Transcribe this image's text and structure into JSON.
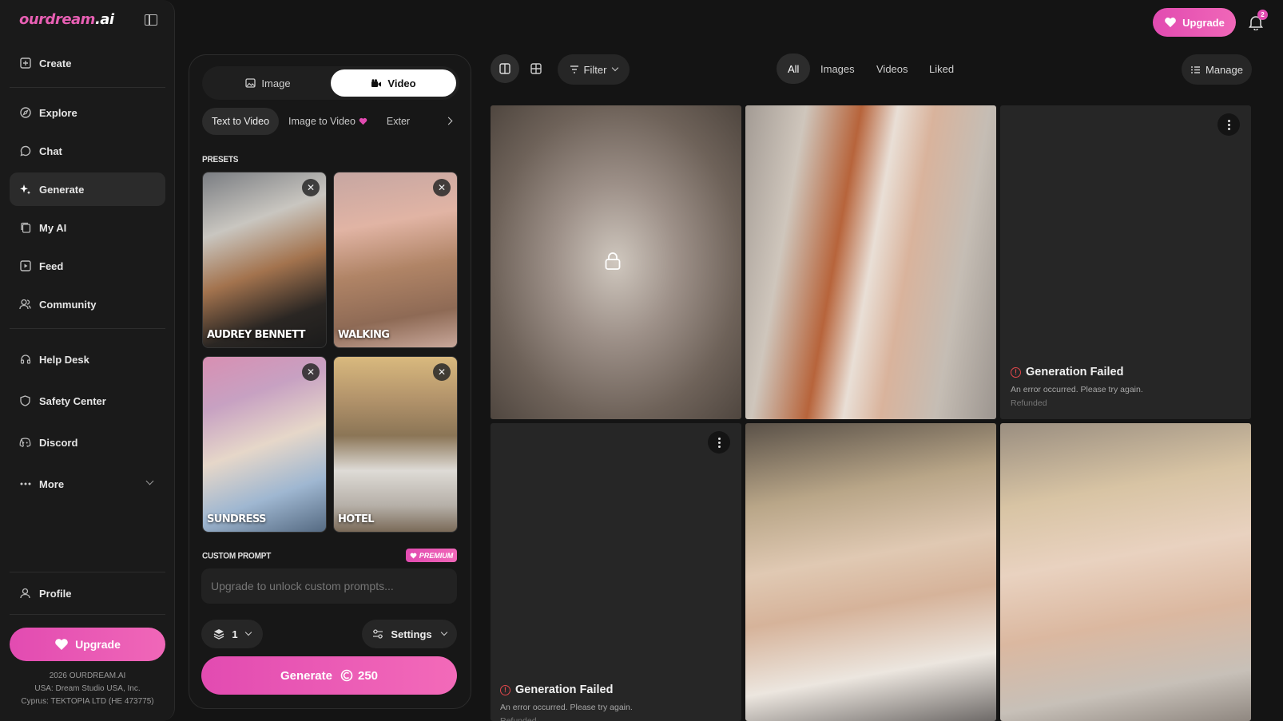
{
  "brand": {
    "name_part1": "ourdream",
    "name_part2": ".ai"
  },
  "sidebar": {
    "items": [
      {
        "label": "Create"
      },
      {
        "label": "Explore"
      },
      {
        "label": "Chat"
      },
      {
        "label": "Generate"
      },
      {
        "label": "My AI"
      },
      {
        "label": "Feed"
      },
      {
        "label": "Community"
      },
      {
        "label": "Help Desk"
      },
      {
        "label": "Safety Center"
      },
      {
        "label": "Discord"
      },
      {
        "label": "More"
      },
      {
        "label": "Profile"
      }
    ],
    "upgrade_label": "Upgrade",
    "footer": [
      "2026 OURDREAM.AI",
      "USA: Dream Studio USA, Inc.",
      "Cyprus: TEKTOPIA LTD (HE 473775)"
    ]
  },
  "topbar": {
    "upgrade_label": "Upgrade",
    "notification_count": "2"
  },
  "panel": {
    "type_tabs": [
      {
        "label": "Image"
      },
      {
        "label": "Video"
      }
    ],
    "modes": [
      {
        "label": "Text to Video"
      },
      {
        "label": "Image to Video"
      },
      {
        "label": "Exter"
      }
    ],
    "presets_label": "PRESETS",
    "presets": [
      {
        "name": "AUDREY BENNETT"
      },
      {
        "name": "WALKING"
      },
      {
        "name": "SUNDRESS"
      },
      {
        "name": "HOTEL"
      }
    ],
    "custom_prompt_label": "CUSTOM PROMPT",
    "premium_badge": "PREMIUM",
    "prompt_placeholder": "Upgrade to unlock custom prompts...",
    "count_value": "1",
    "settings_label": "Settings",
    "generate_label": "Generate",
    "generate_cost": "250"
  },
  "gallery": {
    "filter_label": "Filter",
    "tabs": [
      {
        "label": "All"
      },
      {
        "label": "Images"
      },
      {
        "label": "Videos"
      },
      {
        "label": "Liked"
      }
    ],
    "manage_label": "Manage",
    "fail_title": "Generation Failed",
    "fail_sub": "An error occurred. Please try again.",
    "fail_refund": "Refunded"
  }
}
